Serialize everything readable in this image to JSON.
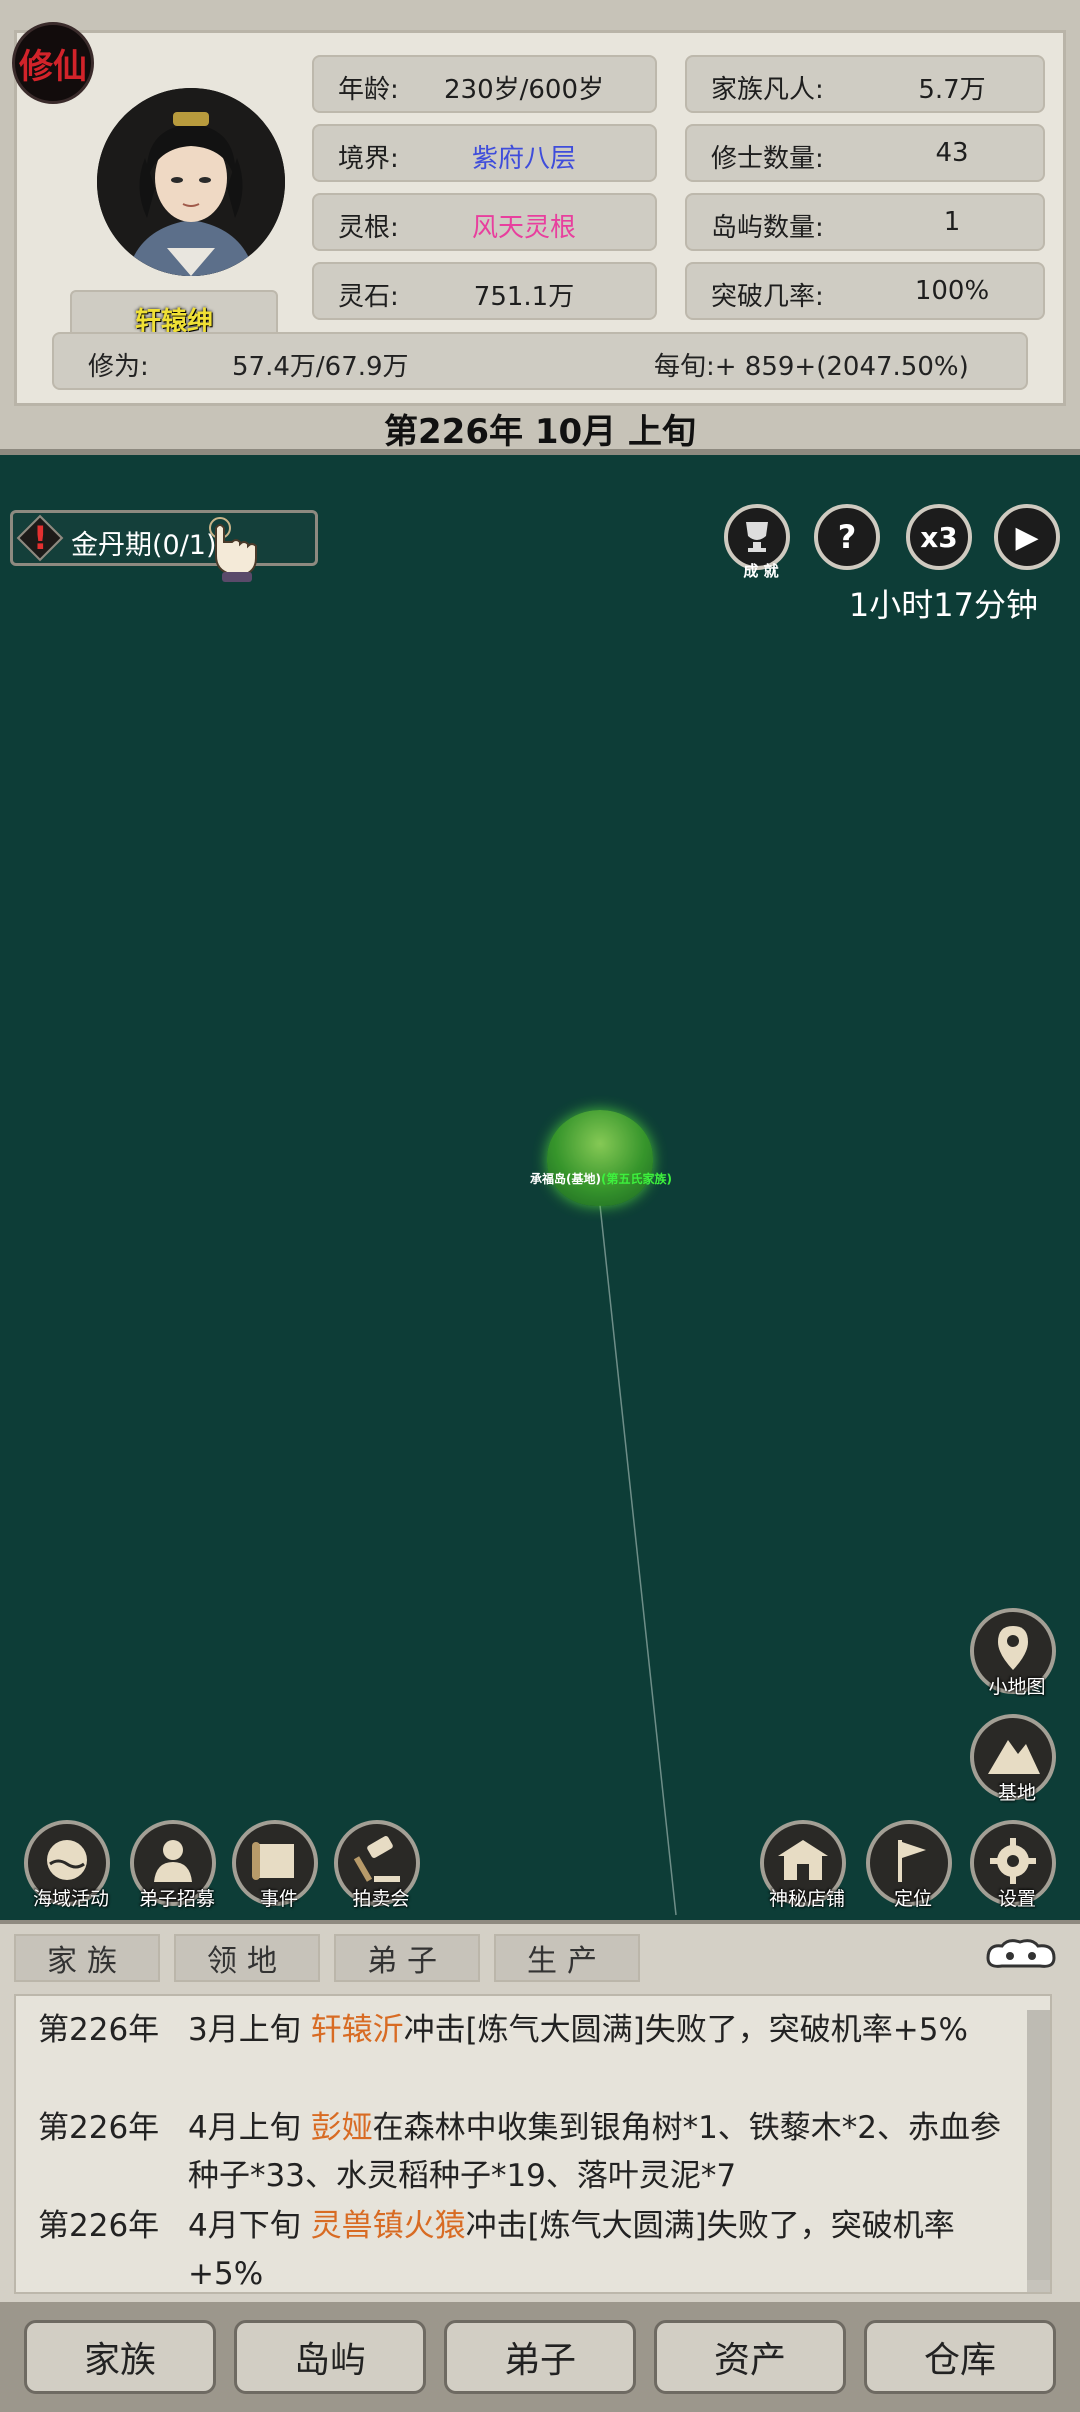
{
  "header": {
    "badge": "修仙",
    "character_name": "轩辕绅",
    "stats_left": [
      {
        "label": "年龄:",
        "value": "230岁/600岁",
        "color": "default"
      },
      {
        "label": "境界:",
        "value": "紫府八层",
        "color": "blue"
      },
      {
        "label": "灵根:",
        "value": "风天灵根",
        "color": "pink"
      },
      {
        "label": "灵石:",
        "value": "751.1万",
        "color": "default"
      }
    ],
    "stats_right": [
      {
        "label": "家族凡人:",
        "value": "5.7万"
      },
      {
        "label": "修士数量:",
        "value": "43"
      },
      {
        "label": "岛屿数量:",
        "value": "1"
      },
      {
        "label": "突破几率:",
        "value": "100%"
      }
    ],
    "cultivation_label": "修为:",
    "cultivation_value": "57.4万/67.9万",
    "per_period": "每旬:+ 859+(2047.50%)",
    "date": "第226年 10月 上旬"
  },
  "map": {
    "quest_chip": "金丹期(0/1)",
    "achievement_label": "成 就",
    "help_icon": "?",
    "speed_label": "x3",
    "play_icon": "▶",
    "timer": "1小时17分钟",
    "island_name": "承福岛(基地)",
    "island_family": "(第五氏家族)",
    "right_tools": [
      {
        "label": "小地图",
        "icon": "map-pin-icon"
      },
      {
        "label": "基地",
        "icon": "mountain-icon"
      }
    ],
    "bottom_left_tools": [
      {
        "label": "海域活动",
        "icon": "sea-activity-icon"
      },
      {
        "label": "弟子招募",
        "icon": "disciple-recruit-icon"
      },
      {
        "label": "事件",
        "icon": "scroll-icon"
      },
      {
        "label": "拍卖会",
        "icon": "gavel-icon"
      }
    ],
    "bottom_right_tools": [
      {
        "label": "神秘店铺",
        "icon": "shop-icon"
      },
      {
        "label": "定位",
        "icon": "flag-icon"
      },
      {
        "label": "设置",
        "icon": "gear-icon"
      }
    ]
  },
  "log": {
    "tabs": [
      "家族",
      "领地",
      "弟子",
      "生产"
    ],
    "entries": [
      {
        "year": "第226年",
        "prefix": "3月上旬 ",
        "name": "轩辕沂",
        "rest": "冲击[炼气大圆满]失败了，突破机率+5%"
      },
      {
        "year": "第226年",
        "prefix": "4月上旬 ",
        "name": "彭娅",
        "rest": "在森林中收集到银角树*1、铁藜木*2、赤血参种子*33、水灵稻种子*19、落叶灵泥*7"
      },
      {
        "year": "第226年",
        "prefix": "4月下旬 ",
        "name": "灵兽镇火猿",
        "rest": "冲击[炼气大圆满]失败了，突破机率+5%"
      }
    ]
  },
  "bottom_nav": [
    "家族",
    "岛屿",
    "弟子",
    "资产",
    "仓库"
  ],
  "colors": {
    "sea": "#0d3d37",
    "name_highlight": "#d86b23",
    "realm_blue": "#3f4ddb",
    "root_pink": "#e83f9e"
  }
}
